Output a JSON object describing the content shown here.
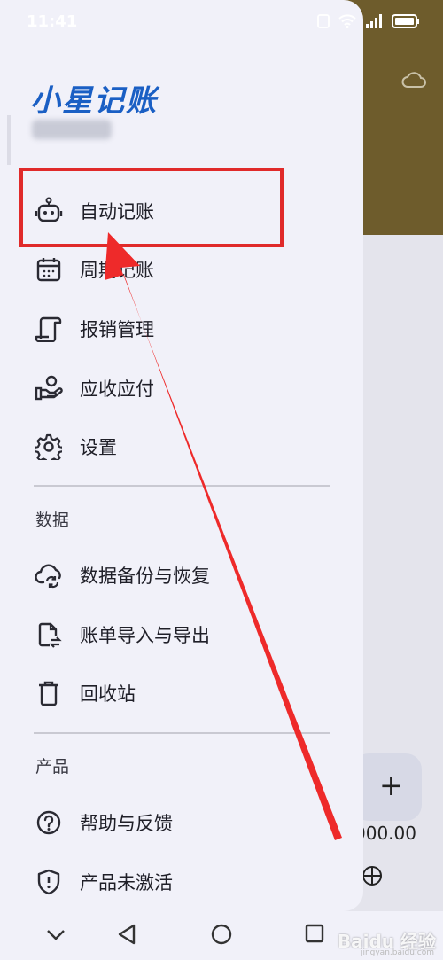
{
  "status": {
    "time": "11:41"
  },
  "brand": {
    "title": "小星记账"
  },
  "menu": [
    {
      "label": "自动记账",
      "icon": "robot-icon"
    },
    {
      "label": "周期记账",
      "icon": "calendar-icon"
    },
    {
      "label": "报销管理",
      "icon": "document-icon"
    },
    {
      "label": "应收应付",
      "icon": "hand-coin-icon"
    },
    {
      "label": "设置",
      "icon": "gear-icon"
    }
  ],
  "section_data": "数据",
  "data_menu": [
    {
      "label": "数据备份与恢复",
      "icon": "cloud-sync-icon"
    },
    {
      "label": "账单导入与导出",
      "icon": "file-transfer-icon"
    },
    {
      "label": "回收站",
      "icon": "trash-icon"
    }
  ],
  "section_product": "产品",
  "product_menu": [
    {
      "label": "帮助与反馈",
      "icon": "help-icon"
    },
    {
      "label": "产品未激活",
      "icon": "shield-alert-icon"
    }
  ],
  "background": {
    "amount": "000.00",
    "fab_label": "+"
  },
  "watermark": {
    "text": "Baidu 经验",
    "sub": "jingyan.baidu.com"
  },
  "colors": {
    "brand": "#1a5fc4",
    "highlight": "#e02a2a",
    "drawer_bg": "#f1f1f9"
  }
}
